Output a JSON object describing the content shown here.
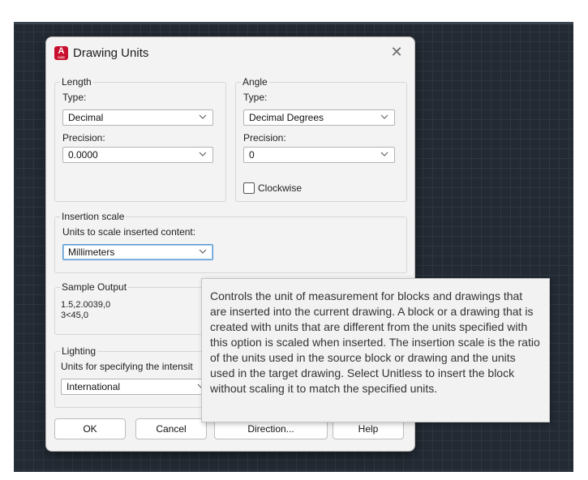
{
  "dialog": {
    "title": "Drawing Units",
    "app_icon_letter": "A",
    "app_icon_sub": "CAD",
    "close_glyph": "✕"
  },
  "length": {
    "legend": "Length",
    "type_label": "Type:",
    "type_value": "Decimal",
    "precision_label": "Precision:",
    "precision_value": "0.0000"
  },
  "angle": {
    "legend": "Angle",
    "type_label": "Type:",
    "type_value": "Decimal Degrees",
    "precision_label": "Precision:",
    "precision_value": "0",
    "clockwise_label": "Clockwise",
    "clockwise_checked": false
  },
  "insertion": {
    "legend": "Insertion scale",
    "label": "Units to scale inserted content:",
    "value": "Millimeters"
  },
  "sample": {
    "legend": "Sample Output",
    "line1": "1.5,2.0039,0",
    "line2": "3<45,0"
  },
  "lighting": {
    "legend": "Lighting",
    "label": "Units for specifying the intensit",
    "value": "International"
  },
  "buttons": {
    "ok": "OK",
    "cancel": "Cancel",
    "direction": "Direction...",
    "help": "Help"
  },
  "tooltip": {
    "text": "Controls the unit of measurement for blocks and drawings that are inserted into the current drawing. A block or a drawing that is created with units that are different from the units specified with this option is scaled when inserted. The insertion scale is the ratio of the units used in the source block or drawing and the units used in the target drawing. Select Unitless to insert the block without scaling it to match the specified units."
  },
  "icons": {
    "chevron": "chevron-down-icon",
    "close": "close-icon",
    "app": "autocad-app-icon"
  },
  "colors": {
    "canvas_bg": "#232a33",
    "dialog_bg": "#f3f3f3",
    "icon_red": "#c8102e",
    "focus_blue": "#5a9bd4"
  }
}
